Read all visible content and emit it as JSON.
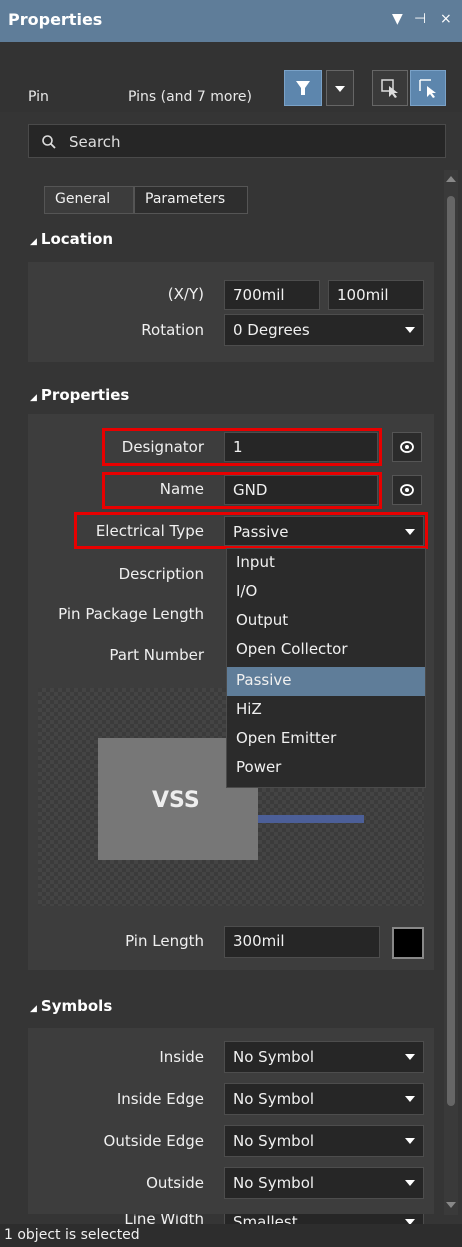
{
  "panel": {
    "title": "Properties",
    "controls": [
      "▼",
      "⊣",
      "×"
    ]
  },
  "toolbar": {
    "kind": "Pin",
    "filter_text": "Pins (and 7 more)"
  },
  "search": {
    "placeholder": "Search"
  },
  "tabs": [
    "General",
    "Parameters"
  ],
  "location": {
    "header": "Location",
    "xy_label": "(X/Y)",
    "x": "700mil",
    "y": "100mil",
    "rotation_label": "Rotation",
    "rotation": "0 Degrees"
  },
  "properties": {
    "header": "Properties",
    "designator_label": "Designator",
    "designator": "1",
    "name_label": "Name",
    "name": "GND",
    "electrical_type_label": "Electrical Type",
    "electrical_type": "Passive",
    "description_label": "Description",
    "pin_package_length_label": "Pin Package Length",
    "part_number_label": "Part Number",
    "preview_text": "VSS",
    "pin_length_label": "Pin Length",
    "pin_length": "300mil"
  },
  "electrical_type_options": [
    "Input",
    "I/O",
    "Output",
    "Open Collector",
    "Passive",
    "HiZ",
    "Open Emitter",
    "Power"
  ],
  "electrical_type_selected": "Passive",
  "symbols": {
    "header": "Symbols",
    "inside_label": "Inside",
    "inside": "No Symbol",
    "inside_edge_label": "Inside Edge",
    "inside_edge": "No Symbol",
    "outside_edge_label": "Outside Edge",
    "outside_edge": "No Symbol",
    "outside_label": "Outside",
    "outside": "No Symbol",
    "line_width_label": "Line Width",
    "line_width": "Smallest"
  },
  "status": "1 object is selected",
  "colors": {
    "titlebar": "#5f7d99",
    "accent": "#5d86ad",
    "highlight_border": "#e80000",
    "selected_item": "#5f7d99"
  }
}
